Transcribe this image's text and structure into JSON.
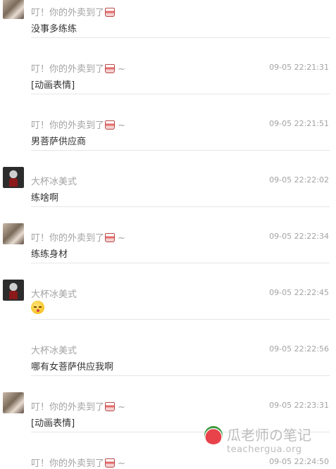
{
  "messages": [
    {
      "sender": "叮！你的外卖到了",
      "cup": true,
      "tilde": "",
      "time": "",
      "body": "没事多练练",
      "avatar": "style-a",
      "emoji": false
    },
    {
      "sender": "叮！你的外卖到了",
      "cup": true,
      "tilde": "~",
      "time": "09-05 22:21:31",
      "body": "[动画表情]",
      "avatar": "",
      "emoji": false
    },
    {
      "sender": "叮！你的外卖到了",
      "cup": true,
      "tilde": "~",
      "time": "09-05 22:21:51",
      "body": "男菩萨供应商",
      "avatar": "",
      "emoji": false
    },
    {
      "sender": "大杯冰美式",
      "cup": false,
      "tilde": "",
      "time": "09-05 22:22:02",
      "body": "练啥啊",
      "avatar": "style-b",
      "emoji": false
    },
    {
      "sender": "叮！你的外卖到了",
      "cup": true,
      "tilde": "~",
      "time": "09-05 22:22:34",
      "body": "练练身材",
      "avatar": "style-a",
      "emoji": false
    },
    {
      "sender": "大杯冰美式",
      "cup": false,
      "tilde": "",
      "time": "09-05 22:22:45",
      "body": "",
      "avatar": "style-b",
      "emoji": true
    },
    {
      "sender": "大杯冰美式",
      "cup": false,
      "tilde": "",
      "time": "09-05 22:22:56",
      "body": "哪有女菩萨供应我啊",
      "avatar": "",
      "emoji": false
    },
    {
      "sender": "叮！你的外卖到了",
      "cup": true,
      "tilde": "~",
      "time": "09-05 22:23:31",
      "body": "[动画表情]",
      "avatar": "style-a",
      "emoji": false
    },
    {
      "sender": "叮！你的外卖到了",
      "cup": true,
      "tilde": "~",
      "time": "09-05 22:24:50",
      "body": "",
      "avatar": "",
      "emoji": false
    }
  ],
  "icons": {
    "cup": "takeout-cup-icon",
    "emoji": "kiss-face-emoji-icon"
  },
  "watermark": {
    "title": "瓜老师の笔记",
    "url": "teachergua.org"
  }
}
